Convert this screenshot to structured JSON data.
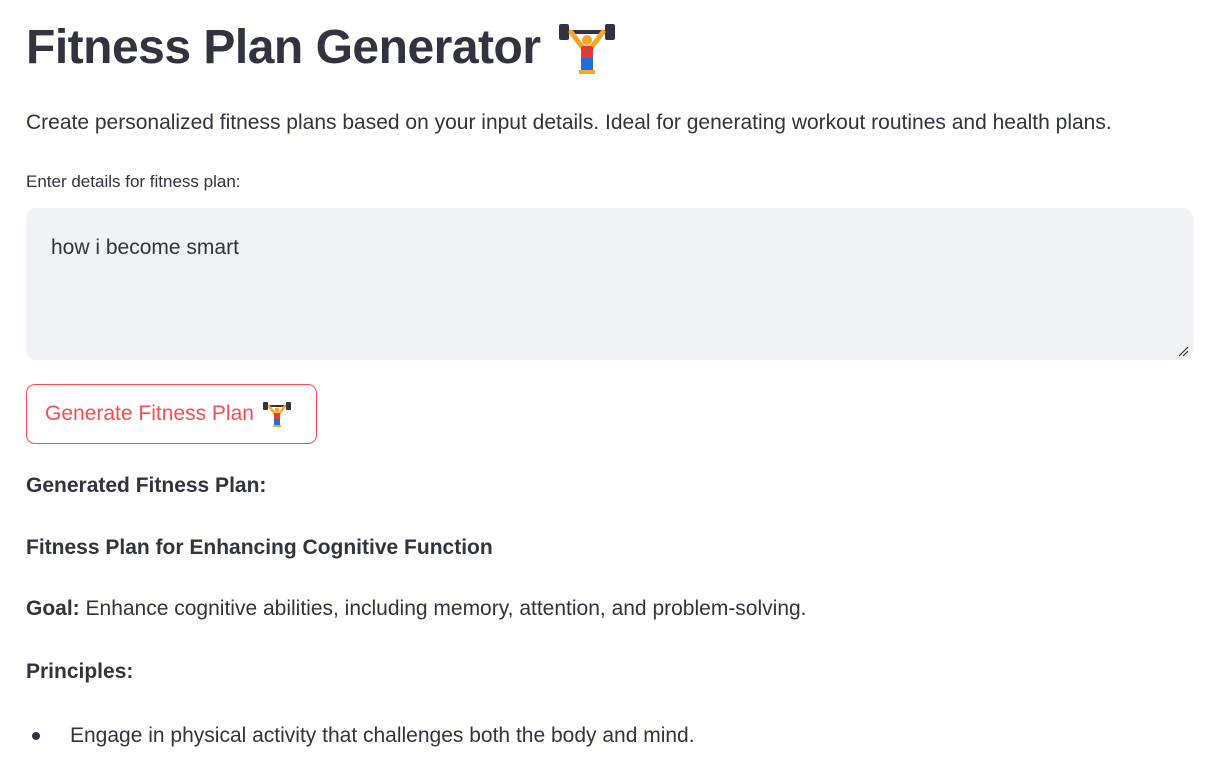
{
  "header": {
    "title": "Fitness Plan Generator",
    "title_icon": "weightlifter-icon"
  },
  "description": "Create personalized fitness plans based on your input details. Ideal for generating workout routines and health plans.",
  "form": {
    "label": "Enter details for fitness plan:",
    "value": "how i become smart"
  },
  "button": {
    "label": "Generate Fitness Plan",
    "icon": "weightlifter-icon"
  },
  "output": {
    "heading": "Generated Fitness Plan:",
    "plan_title": "Fitness Plan for Enhancing Cognitive Function",
    "goal_label": "Goal:",
    "goal_text": " Enhance cognitive abilities, including memory, attention, and problem-solving.",
    "principles_label": "Principles:",
    "principles": [
      "Engage in physical activity that challenges both the body and mind."
    ]
  },
  "colors": {
    "text": "#31333f",
    "accent": "#ff4b4b",
    "input_bg": "#f0f2f6"
  }
}
